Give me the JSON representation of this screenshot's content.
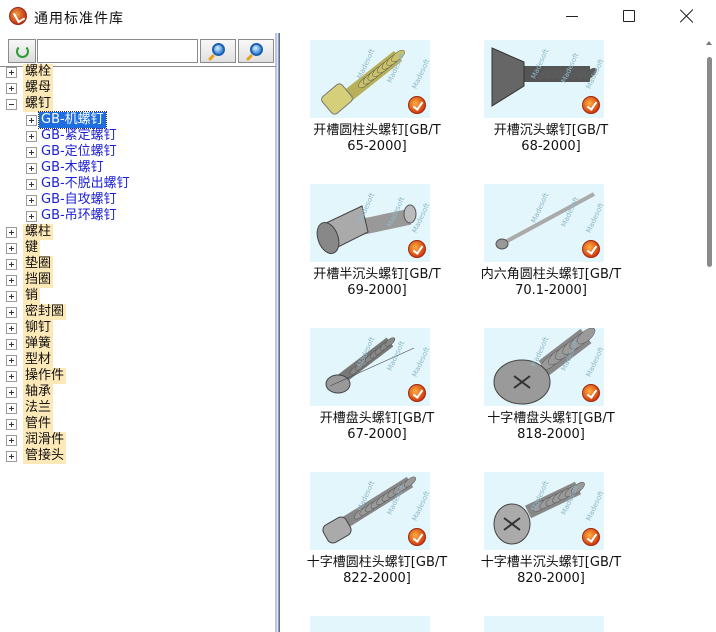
{
  "window": {
    "title": "通用标准件库",
    "minimize_icon": "minimize-icon",
    "maximize_icon": "maximize-icon",
    "close_icon": "close-icon"
  },
  "toolbar": {
    "refresh_icon": "refresh-icon",
    "search_value": "",
    "search_icon_1": "magnifier-icon",
    "search_icon_2": "magnifier-icon"
  },
  "tree": {
    "categories": [
      "螺栓",
      "螺母",
      "螺钉",
      "螺柱",
      "键",
      "垫圈",
      "挡圈",
      "销",
      "密封圈",
      "铆钉",
      "弹簧",
      "型材",
      "操作件",
      "轴承",
      "法兰",
      "管件",
      "润滑件",
      "管接头"
    ],
    "expanded": "螺钉",
    "screw_children": [
      "GB-机螺钉",
      "GB-紧定螺钉",
      "GB-定位螺钉",
      "GB-木螺钉",
      "GB-不脱出螺钉",
      "GB-自攻螺钉",
      "GB-吊环螺钉"
    ],
    "selected": "GB-机螺钉"
  },
  "gallery": {
    "watermark": "Madesoft",
    "items": [
      {
        "line1": "开槽圆柱头螺钉[GB/T",
        "line2": "65-2000]",
        "icon": "slotted-cheese-head-screw-icon"
      },
      {
        "line1": "开槽沉头螺钉[GB/T",
        "line2": "68-2000]",
        "icon": "slotted-countersunk-screw-icon"
      },
      {
        "line1": "开槽半沉头螺钉[GB/T",
        "line2": "69-2000]",
        "icon": "slotted-raised-countersunk-screw-icon"
      },
      {
        "line1": "内六角圆柱头螺钉[GB/T",
        "line2": "70.1-2000]",
        "icon": "hexagon-socket-cap-screw-icon"
      },
      {
        "line1": "开槽盘头螺钉[GB/T",
        "line2": "67-2000]",
        "icon": "slotted-pan-head-screw-icon"
      },
      {
        "line1": "十字槽盘头螺钉[GB/T",
        "line2": "818-2000]",
        "icon": "cross-recessed-pan-head-screw-icon"
      },
      {
        "line1": "十字槽圆柱头螺钉[GB/T",
        "line2": "822-2000]",
        "icon": "cross-recessed-cheese-head-screw-icon"
      },
      {
        "line1": "十字槽半沉头螺钉[GB/T",
        "line2": "820-2000]",
        "icon": "cross-recessed-raised-countersunk-screw-icon"
      }
    ]
  }
}
